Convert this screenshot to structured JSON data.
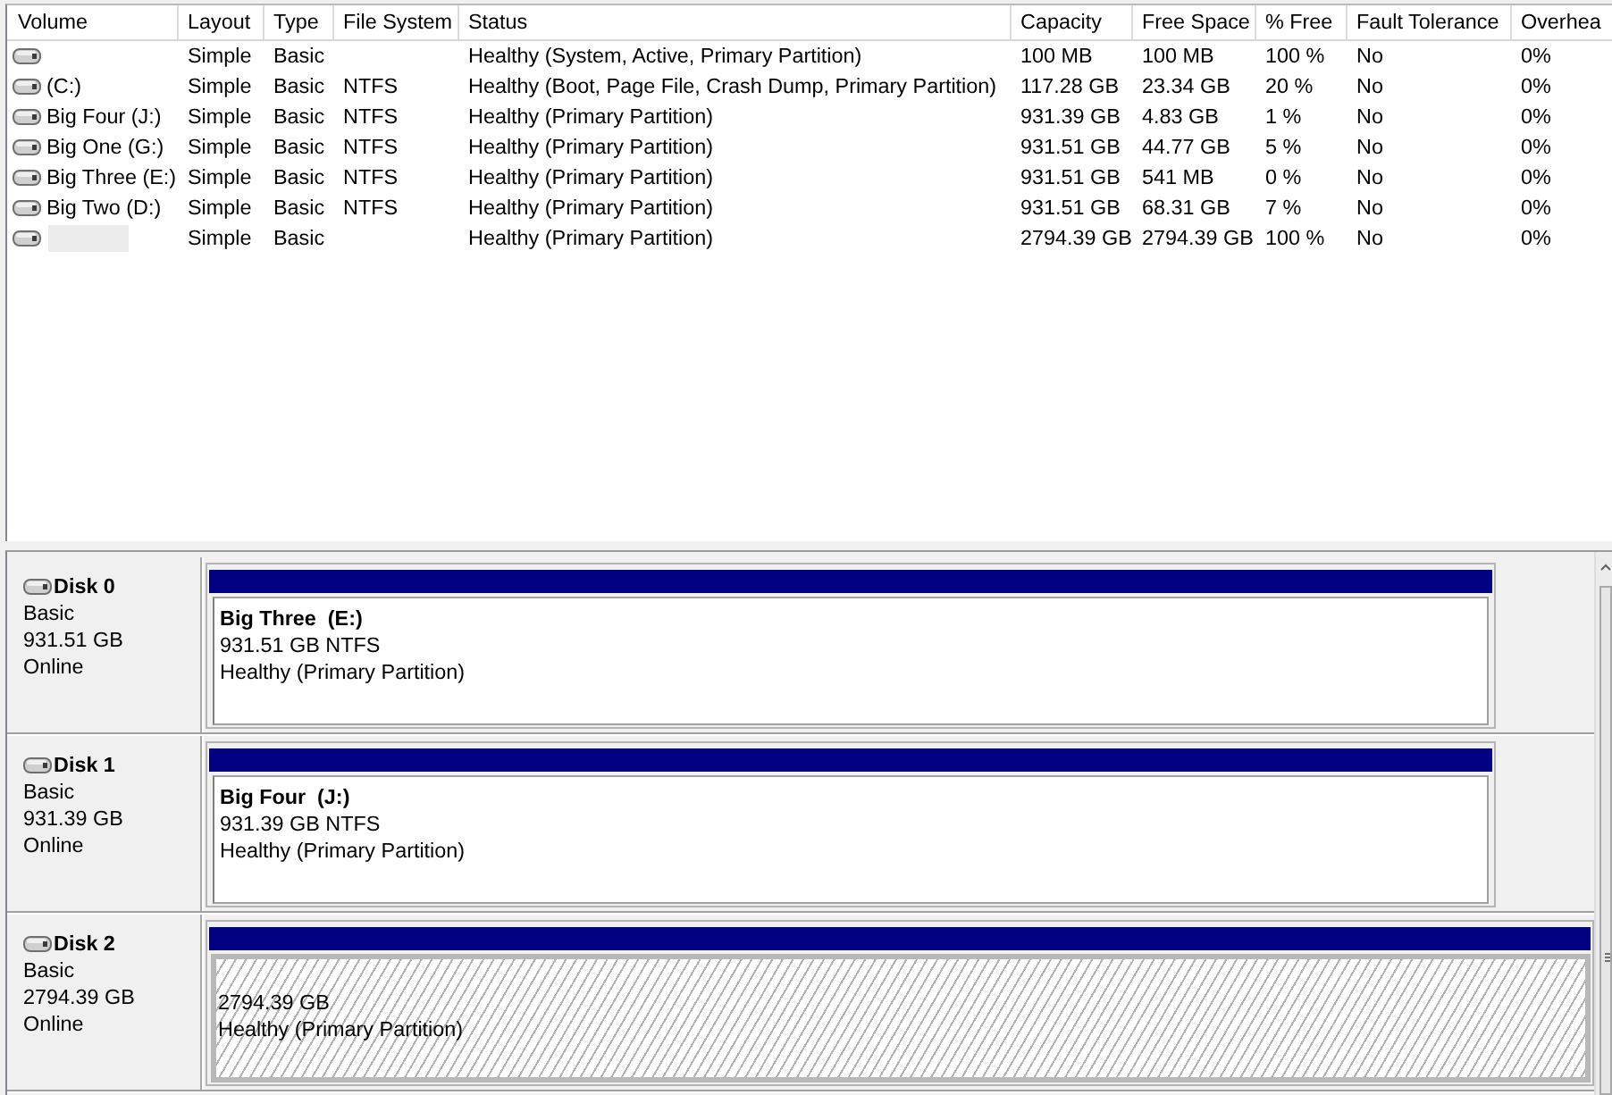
{
  "volume_list": {
    "columns": [
      "Volume",
      "Layout",
      "Type",
      "File System",
      "Status",
      "Capacity",
      "Free Space",
      "% Free",
      "Fault Tolerance",
      "Overhea"
    ],
    "rows": [
      {
        "redacted": false,
        "layout": "Simple",
        "type": "Basic",
        "status": "Healthy (System, Active, Primary Partition)",
        "capacity": "100 MB",
        "free_space": "100 MB",
        "percent_free": "100 %",
        "fault_tolerance": "No",
        "overhead": "0%"
      },
      {
        "volume": "(C:)",
        "redacted": false,
        "layout": "Simple",
        "type": "Basic",
        "file_system": "NTFS",
        "status": "Healthy (Boot, Page File, Crash Dump, Primary Partition)",
        "capacity": "117.28 GB",
        "free_space": "23.34 GB",
        "percent_free": "20 %",
        "fault_tolerance": "No",
        "overhead": "0%"
      },
      {
        "volume": "Big Four (J:)",
        "redacted": false,
        "layout": "Simple",
        "type": "Basic",
        "file_system": "NTFS",
        "status": "Healthy (Primary Partition)",
        "capacity": "931.39 GB",
        "free_space": "4.83 GB",
        "percent_free": "1 %",
        "fault_tolerance": "No",
        "overhead": "0%"
      },
      {
        "volume": "Big One (G:)",
        "redacted": false,
        "layout": "Simple",
        "type": "Basic",
        "file_system": "NTFS",
        "status": "Healthy (Primary Partition)",
        "capacity": "931.51 GB",
        "free_space": "44.77 GB",
        "percent_free": "5 %",
        "fault_tolerance": "No",
        "overhead": "0%"
      },
      {
        "volume": "Big Three (E:)",
        "redacted": false,
        "layout": "Simple",
        "type": "Basic",
        "file_system": "NTFS",
        "status": "Healthy (Primary Partition)",
        "capacity": "931.51 GB",
        "free_space": "541 MB",
        "percent_free": "0 %",
        "fault_tolerance": "No",
        "overhead": "0%"
      },
      {
        "volume": "Big Two (D:)",
        "redacted": false,
        "layout": "Simple",
        "type": "Basic",
        "file_system": "NTFS",
        "status": "Healthy (Primary Partition)",
        "capacity": "931.51 GB",
        "free_space": "68.31 GB",
        "percent_free": "7 %",
        "fault_tolerance": "No",
        "overhead": "0%"
      },
      {
        "redacted": true,
        "layout": "Simple",
        "type": "Basic",
        "status": "Healthy (Primary Partition)",
        "capacity": "2794.39 GB",
        "free_space": "2794.39 GB",
        "percent_free": "100 %",
        "fault_tolerance": "No",
        "overhead": "0%"
      }
    ]
  },
  "disks": [
    {
      "name": "Disk 0",
      "type": "Basic",
      "size": "931.51 GB",
      "status": "Online",
      "partitions": [
        {
          "name": "Big Three  (E:)",
          "size": "931.51 GB NTFS",
          "status": "Healthy (Primary Partition)",
          "selected": false
        }
      ]
    },
    {
      "name": "Disk 1",
      "type": "Basic",
      "size": "931.39 GB",
      "status": "Online",
      "partitions": [
        {
          "name": "Big Four  (J:)",
          "size": "931.39 GB NTFS",
          "status": "Healthy (Primary Partition)",
          "selected": false
        }
      ]
    },
    {
      "name": "Disk 2",
      "type": "Basic",
      "size": "2794.39 GB",
      "status": "Online",
      "partitions": [
        {
          "size": "2794.39 GB",
          "status": "Healthy (Primary Partition)",
          "selected": true
        }
      ]
    }
  ]
}
